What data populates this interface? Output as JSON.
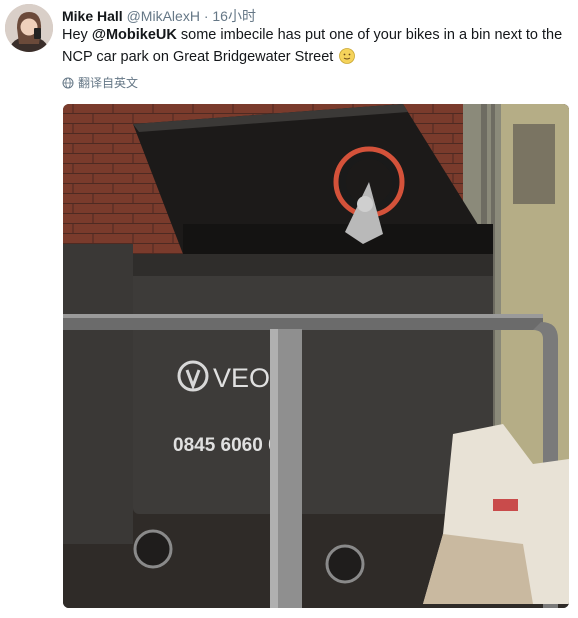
{
  "tweet": {
    "author_name": "Mike Hall",
    "author_handle": "@MikAlexH",
    "separator": "·",
    "timestamp": "16小时",
    "text_prefix": "Hey ",
    "mention": "@MobikeUK",
    "text_suffix": " some imbecile has put one of your bikes in a bin next to the NCP car park on Great Bridgewater Street",
    "emoji_icon": "slightly-smiling-face-icon",
    "translate_label": "翻译自英文",
    "translate_icon": "globe-icon"
  },
  "photo": {
    "bin_brand": "VEO",
    "bin_phone": "0845 6060 0",
    "colors": {
      "brick": "#7a3b2c",
      "bin": "#3d3b39",
      "wheel_rim": "#d4523a"
    }
  }
}
